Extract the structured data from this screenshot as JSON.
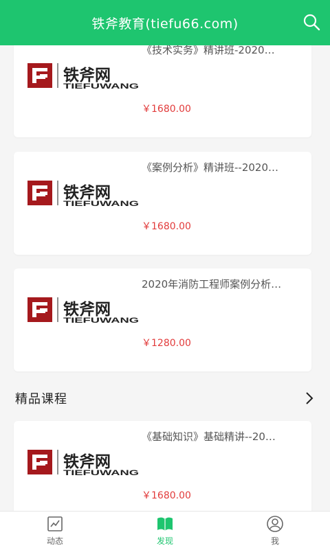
{
  "header": {
    "title": "铁斧教育(tiefu66.com)",
    "bg_color": "#1ec56f",
    "search_icon": "search-icon"
  },
  "cards_top": [
    {
      "title": "《技术实务》精讲班-2020…",
      "logo_cn": "铁斧网",
      "logo_en": "TIEFUWANG",
      "price": "￥1680.00"
    },
    {
      "title": "《案例分析》精讲班--2020…",
      "logo_cn": "铁斧网",
      "logo_en": "TIEFUWANG",
      "price": "￥1680.00"
    },
    {
      "title": "2020年消防工程师案例分析…",
      "logo_cn": "铁斧网",
      "logo_en": "TIEFUWANG",
      "price": "￥1280.00"
    }
  ],
  "section": {
    "title": "精品课程",
    "more_icon": "chevron-right-icon"
  },
  "cards_bottom": [
    {
      "title": "《基础知识》基础精讲--20…",
      "logo_cn": "铁斧网",
      "logo_en": "TIEFUWANG",
      "price": "￥1680.00"
    }
  ],
  "tabbar": {
    "items": [
      {
        "label": "动态",
        "icon": "trend-chart-icon",
        "active": false
      },
      {
        "label": "发现",
        "icon": "book-icon",
        "active": true
      },
      {
        "label": "我",
        "icon": "user-icon",
        "active": false
      }
    ],
    "active_color": "#1ec56f"
  },
  "colors": {
    "price": "#e23b3b",
    "logo_red": "#a5191d"
  }
}
